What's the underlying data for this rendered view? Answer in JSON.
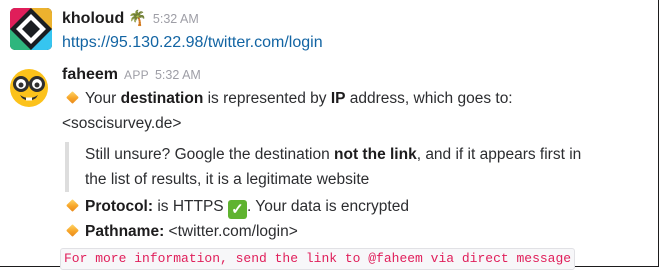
{
  "message1": {
    "sender": "kholoud",
    "status_emoji": "🌴",
    "time": "5:32 AM",
    "link": "https://95.130.22.98/twitter.com/login"
  },
  "message2": {
    "sender": "faheem",
    "badge": "APP",
    "time": "5:32 AM",
    "line1": {
      "t1": "Your ",
      "b1": "destination",
      "t2": " is represented by ",
      "b2": "IP",
      "t3": " address, which goes to:"
    },
    "line1b": "<soscisurvey.de>",
    "quote": {
      "t1": "Still unsure? Google the destination ",
      "b1": "not the link",
      "t2": ", and if it appears first in the list of results, it is a legitimate website"
    },
    "protocol": {
      "label": "Protocol:",
      "t1": " is HTTPS ",
      "check": "✓",
      "t2": ". Your data is encrypted"
    },
    "pathname": {
      "label": "Pathname:",
      "value": " <twitter.com/login>"
    },
    "footer_code": "For more information, send the link to @faheem via direct message"
  },
  "colors": {
    "link": "#1264a3",
    "code_text": "#e01e5a",
    "check_bg": "#5fb330",
    "quote_border": "#dddddd"
  },
  "icons": {
    "avatar1": "slack-style-logo-avatar",
    "avatar2": "nerd-face-emoji-avatar",
    "bullet": "orange-diamond-icon",
    "check": "check-mark-button-icon"
  }
}
